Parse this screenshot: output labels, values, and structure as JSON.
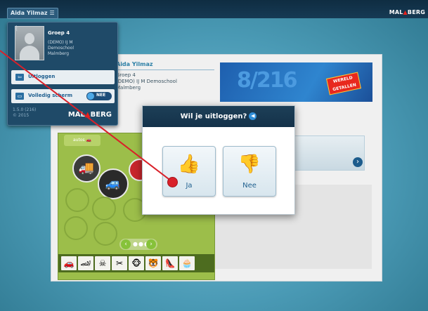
{
  "topbar": {
    "user_button": "Aida Yilmaz",
    "menu_icon": "hamburger-icon",
    "brand_left": "MAL",
    "brand_right": "BERG"
  },
  "student_header": {
    "name": "Aida Yilmaz",
    "group": "Groep 4",
    "school_line1": "(DEMO) IJ M Demoschool",
    "school_line2": "Malmberg"
  },
  "banner": {
    "numbers": "8/216",
    "badge_line1": "WERELD",
    "badge_line2": "GETALLEN"
  },
  "user_popover": {
    "group": "Groep 4",
    "school_line1": "(DEMO) IJ M",
    "school_line2": "Demoschool",
    "school_line3": "Malmberg",
    "logout_label": "Uitloggen",
    "fullscreen_label": "Volledig scherm",
    "fullscreen_state": "NEE",
    "version_line1": "1.5.0 (216)",
    "version_line2": "© 2015",
    "brand_left": "MAL",
    "brand_right": "BERG"
  },
  "board": {
    "tab_label": "autos"
  },
  "modal": {
    "title": "Wil je uitloggen?",
    "yes_label": "Ja",
    "no_label": "Nee"
  },
  "colors": {
    "header_dark": "#163a54",
    "accent_blue": "#1f6fb8",
    "brand_red": "#e8201b",
    "pointer_red": "#d9212a",
    "board_green": "#9cbe4a"
  }
}
